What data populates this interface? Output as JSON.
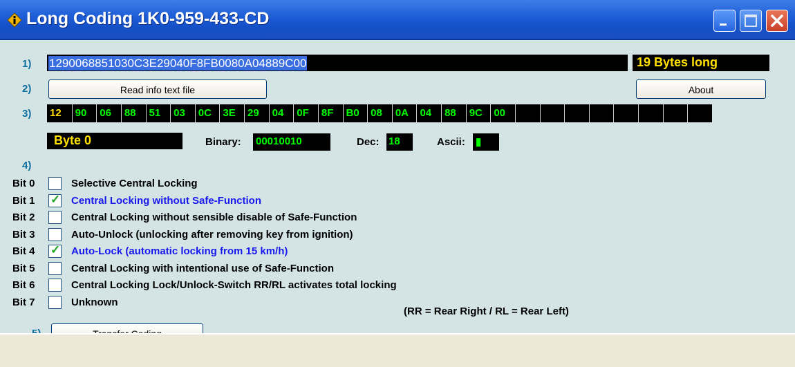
{
  "window": {
    "title": "Long Coding 1K0-959-433-CD",
    "icon": "info-icon"
  },
  "step_labels": [
    "1)",
    "2)",
    "3)",
    "4)",
    "5)"
  ],
  "coding": {
    "value": "1290068851030C3E29040F8FB0080A04889C00",
    "length_label": "19 Bytes long"
  },
  "buttons": {
    "read_info": "Read info text file",
    "about": "About",
    "transfer": "Transfer Coding"
  },
  "bytes": [
    "12",
    "90",
    "06",
    "88",
    "51",
    "03",
    "0C",
    "3E",
    "29",
    "04",
    "0F",
    "8F",
    "B0",
    "08",
    "0A",
    "04",
    "88",
    "9C",
    "00",
    "",
    "",
    "",
    "",
    "",
    "",
    "",
    ""
  ],
  "selected_byte_index": 0,
  "byte_info": {
    "label": "Byte 0",
    "binary_label": "Binary:",
    "binary_value": "00010010",
    "dec_label": "Dec:",
    "dec_value": "18",
    "ascii_label": "Ascii:",
    "ascii_value": "▮"
  },
  "bits": [
    {
      "label": "Bit 0",
      "text": "Selective Central Locking",
      "checked": false
    },
    {
      "label": "Bit 1",
      "text": "Central Locking without Safe-Function",
      "checked": true
    },
    {
      "label": "Bit 2",
      "text": "Central Locking without sensible disable of Safe-Function",
      "checked": false
    },
    {
      "label": "Bit 3",
      "text": "Auto-Unlock (unlocking after removing key from ignition)",
      "checked": false
    },
    {
      "label": "Bit 4",
      "text": "Auto-Lock (automatic locking from 15 km/h)",
      "checked": true
    },
    {
      "label": "Bit 5",
      "text": "Central Locking with intentional use of Safe-Function",
      "checked": false
    },
    {
      "label": "Bit 6",
      "text": "Central Locking Lock/Unlock-Switch RR/RL activates total locking",
      "checked": false
    },
    {
      "label": "Bit 7",
      "text": "Unknown",
      "checked": false
    }
  ],
  "footnote": "(RR = Rear Right / RL = Rear Left)",
  "colors": {
    "titlebar": "#1f5fd8",
    "client_bg": "#d4e4e4",
    "step_label": "#0a6ea0",
    "highlight_yellow": "#ffe000",
    "highlight_green": "#00ff00",
    "checked_text": "#1818ee"
  }
}
